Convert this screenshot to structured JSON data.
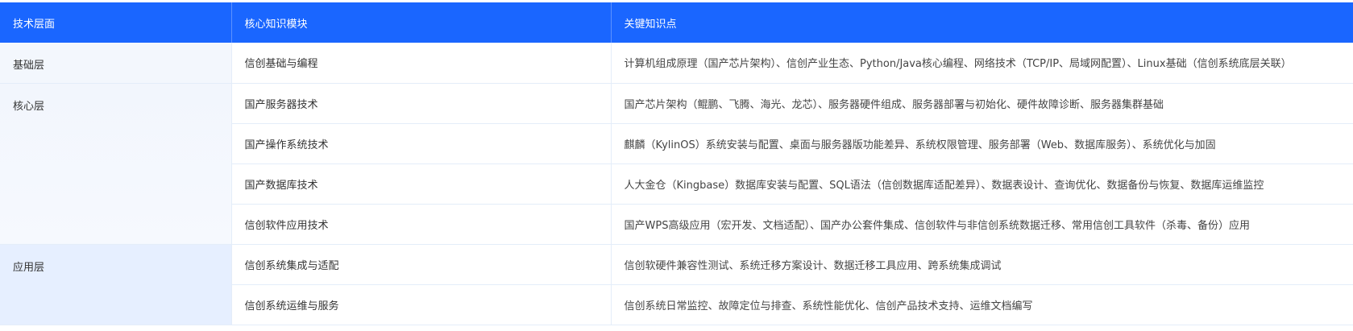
{
  "table": {
    "headers": [
      "技术层面",
      "核心知识模块",
      "关键知识点"
    ],
    "layers": {
      "basic": "基础层",
      "core": "核心层",
      "app": "应用层"
    },
    "rows": [
      {
        "module": "信创基础与编程",
        "points": "计算机组成原理（国产芯片架构）、信创产业生态、Python/Java核心编程、网络技术（TCP/IP、局域网配置）、Linux基础（信创系统底层关联）"
      },
      {
        "module": "国产服务器技术",
        "points": "国产芯片架构（鲲鹏、飞腾、海光、龙芯）、服务器硬件组成、服务器部署与初始化、硬件故障诊断、服务器集群基础"
      },
      {
        "module": "国产操作系统技术",
        "points": "麒麟（KylinOS）系统安装与配置、桌面与服务器版功能差异、系统权限管理、服务部署（Web、数据库服务）、系统优化与加固"
      },
      {
        "module": "国产数据库技术",
        "points": "人大金仓（Kingbase）数据库安装与配置、SQL语法（信创数据库适配差异）、数据表设计、查询优化、数据备份与恢复、数据库运维监控"
      },
      {
        "module": "信创软件应用技术",
        "points": "国产WPS高级应用（宏开发、文档适配）、国产办公套件集成、信创软件与非信创系统数据迁移、常用信创工具软件（杀毒、备份）应用"
      },
      {
        "module": "信创系统集成与适配",
        "points": "信创软硬件兼容性测试、系统迁移方案设计、数据迁移工具应用、跨系统集成调试"
      },
      {
        "module": "信创系统运维与服务",
        "points": "信创系统日常监控、故障定位与排查、系统性能优化、信创产品技术支持、运维文档编写"
      }
    ]
  }
}
